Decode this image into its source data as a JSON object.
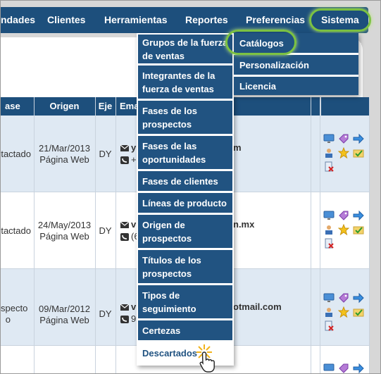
{
  "nav": {
    "items": [
      "ndades",
      "Clientes",
      "Herramientas",
      "Reportes",
      "Preferencias",
      "Sistema"
    ]
  },
  "table": {
    "headers": [
      "ase",
      "Origen",
      "Eje",
      "Ema"
    ],
    "rows": [
      {
        "fase": "tactado",
        "date": "21/Mar/2013",
        "source": "Página Web",
        "eje": "DY",
        "email_start": "y",
        "email_end": "m",
        "phone_start": "+"
      },
      {
        "fase": "tactado",
        "date": "24/May/2013",
        "source": "Página Web",
        "eje": "DY",
        "email_start": "v",
        "email_end": "n.mx",
        "phone_start": "(6"
      },
      {
        "fase_line1": "specto",
        "fase_line2": "o",
        "date": "09/Mar/2012",
        "source": "Página Web",
        "eje": "DY",
        "email_start": "v",
        "email_end": "otmail.com",
        "phone_start": "9"
      }
    ]
  },
  "dropdown": {
    "items": [
      "Grupos de la fuerza de ventas",
      "Integrantes de la fuerza de ventas",
      "Fases de los prospectos",
      "Fases de las oportunidades",
      "Fases de clientes",
      "Líneas de producto",
      "Origen de prospectos",
      "Títulos de los prospectos",
      "Tipos de seguimiento",
      "Certezas",
      "Descartados"
    ]
  },
  "submenu": {
    "items": [
      "Catálogos",
      "Personalización",
      "Licencia"
    ]
  },
  "colors": {
    "nav_bg": "#1d4f7c",
    "menu_bg": "#215381",
    "highlight": "#7cc242",
    "row_alt": "#dfe9f3"
  },
  "icons": [
    "envelope-icon",
    "phone-icon",
    "monitor-icon",
    "tag-icon",
    "arrow-right-icon",
    "user-edit-icon",
    "star-icon",
    "check-folder-icon",
    "delete-doc-icon",
    "hand-cursor-icon"
  ]
}
